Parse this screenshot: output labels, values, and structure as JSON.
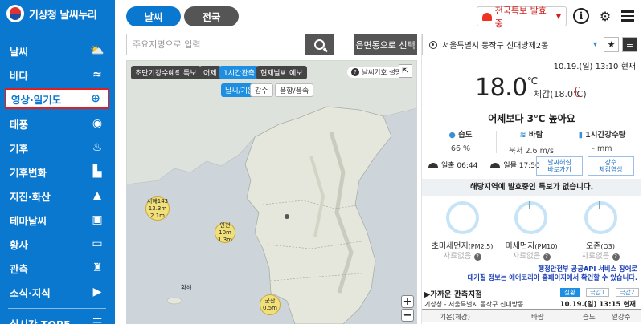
{
  "brand": {
    "title": "기상청 날씨누리"
  },
  "sidebar": {
    "items": [
      {
        "label": "날씨",
        "icon": "cloud-sun-icon"
      },
      {
        "label": "바다",
        "icon": "ocean-icon"
      },
      {
        "label": "영상·일기도",
        "icon": "satellite-icon"
      },
      {
        "label": "태풍",
        "icon": "typhoon-icon"
      },
      {
        "label": "기후",
        "icon": "climate-icon"
      },
      {
        "label": "기후변화",
        "icon": "factory-icon"
      },
      {
        "label": "지진·화산",
        "icon": "volcano-icon"
      },
      {
        "label": "테마날씨",
        "icon": "theme-icon"
      },
      {
        "label": "황사",
        "icon": "dust-icon"
      },
      {
        "label": "관측",
        "icon": "observatory-icon"
      },
      {
        "label": "소식·지식",
        "icon": "video-icon"
      },
      {
        "label": "실시간 TOP5",
        "icon": "list-icon"
      }
    ]
  },
  "top": {
    "tab_weather": "날씨",
    "tab_national": "전국",
    "alert_button": "전국특보 발효중",
    "info": "i"
  },
  "search": {
    "placeholder": "주요지명으로 입력",
    "town_button": "읍면동으로 선택"
  },
  "map": {
    "controls_row1": [
      "초단기강수예측",
      "특보",
      "어제",
      "1시간관측",
      "현재날씨",
      "예보"
    ],
    "controls_row2": [
      "날씨/기온",
      "강수",
      "풍향/풍속"
    ],
    "legend_help": "날씨기호 설명",
    "labels": {
      "sea": "황해"
    },
    "markers": [
      {
        "name": "서해143",
        "value1": "13.3m",
        "value2": "2.1m"
      },
      {
        "name": "인천",
        "value1": "10m",
        "value2": "1.3m"
      },
      {
        "name": "군산",
        "value1": "",
        "value2": "0.5m"
      }
    ],
    "zoom_in": "+",
    "zoom_out": "−"
  },
  "panel": {
    "location": "서울특별시 동작구 신대방제2동",
    "obs_time": "10.19.(일) 13:10 현재",
    "temperature": "18.0",
    "temp_unit": "℃",
    "feels_like": "체감(18.0℃)",
    "compare": "어제보다 3℃ 높아요",
    "metrics": [
      {
        "label": "습도",
        "value": "66 %",
        "icon": "droplet-icon"
      },
      {
        "label": "바람",
        "value": "북서 2.6 m/s",
        "icon": "wind-icon"
      },
      {
        "label": "1시간강수량",
        "value": "- mm",
        "icon": "rain-gauge-icon"
      }
    ],
    "sunrise": "일출 06:44",
    "sunset": "일몰 17:50",
    "btn_weather_map": [
      "날씨해설",
      "바로가기"
    ],
    "btn_rain": [
      "강수",
      "체감영상"
    ],
    "no_alert": "해당지역에 발효중인 특보가 없습니다.",
    "air": [
      {
        "label": "초미세먼지",
        "sub": "(PM2.5)",
        "value": "자료없음"
      },
      {
        "label": "미세먼지",
        "sub": "(PM10)",
        "value": "자료없음"
      },
      {
        "label": "오존",
        "sub": "(O3)",
        "value": "자료없음"
      }
    ],
    "api_note_1": "행정안전부 공공API 서비스 장애로",
    "api_note_2": "대기질 정보는 에어코리아 홈페이지에서 확인할 수 있습니다.",
    "near_title": "▶가까운 관측지점",
    "obs_tabs": [
      "실황",
      "극값1",
      "극값2"
    ],
    "near_location": "기상청 - 서울특별시 동작구 신대방동",
    "near_time": "10.19.(일) 13:15 현재",
    "table_headers": [
      "기온(체감)",
      "바람",
      "습도",
      "일강수"
    ]
  }
}
